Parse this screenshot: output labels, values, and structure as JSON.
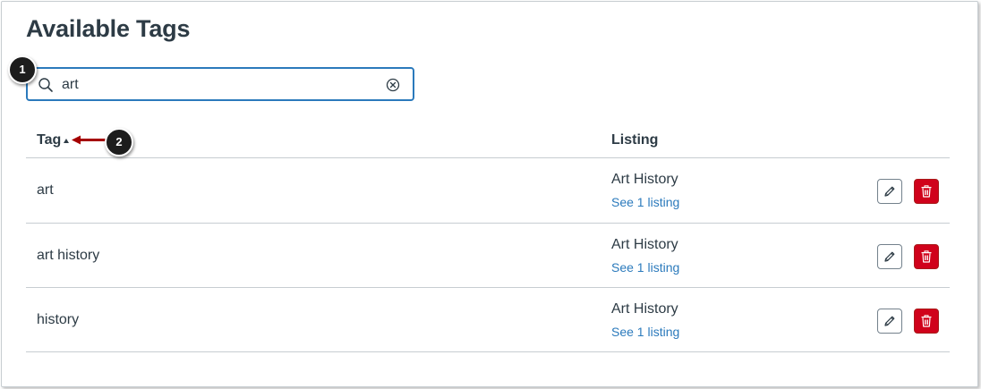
{
  "page": {
    "title": "Available Tags"
  },
  "search": {
    "value": "art",
    "placeholder": ""
  },
  "callouts": {
    "first": "1",
    "second": "2"
  },
  "table": {
    "columns": {
      "tag": "Tag",
      "listing": "Listing"
    },
    "sort": "ascending",
    "rows": [
      {
        "tag": "art",
        "listing": "Art History",
        "link": "See 1 listing"
      },
      {
        "tag": "art history",
        "listing": "Art History",
        "link": "See 1 listing"
      },
      {
        "tag": "history",
        "listing": "Art History",
        "link": "See 1 listing"
      }
    ]
  },
  "icons": {
    "search": "search-icon",
    "clear": "clear-icon",
    "sort": "sort-up-icon",
    "edit": "pencil-icon",
    "delete": "trash-icon"
  },
  "colors": {
    "text": "#2d3b45",
    "link": "#2b7abc",
    "focus_border": "#2b7abc",
    "delete": "#d0021b",
    "callout": "#1d1d1d",
    "arrow": "#a50000"
  }
}
